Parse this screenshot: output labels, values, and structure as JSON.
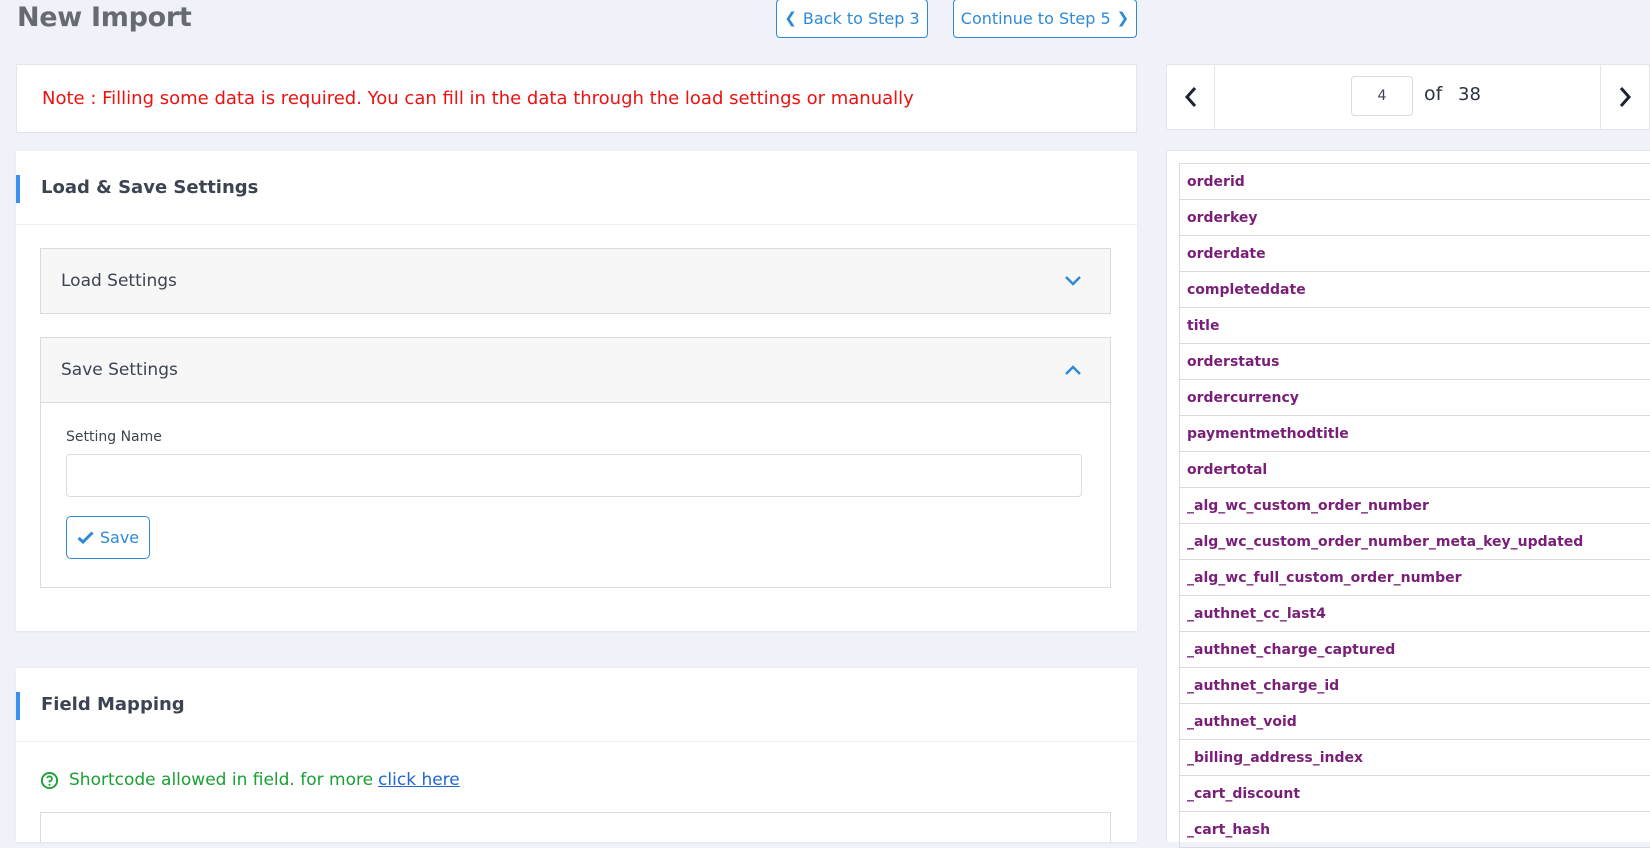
{
  "header": {
    "title": "New Import",
    "back_label": "Back to Step 3",
    "continue_label": "Continue to Step 5"
  },
  "note": {
    "text": "Note : Filling some data is required. You can fill in the data through the load settings or manually"
  },
  "load_save": {
    "title": "Load & Save Settings",
    "load_settings": {
      "label": "Load Settings",
      "expanded": false
    },
    "save_settings": {
      "label": "Save Settings",
      "expanded": true,
      "setting_name_label": "Setting Name",
      "setting_name_value": "",
      "save_label": "Save"
    }
  },
  "field_mapping": {
    "title": "Field Mapping",
    "shortcode_text": "Shortcode allowed in field. for more",
    "link_text": "click here"
  },
  "pager": {
    "current_page": "4",
    "of_label": "of",
    "total_pages": "38"
  },
  "fields": [
    "orderid",
    "orderkey",
    "orderdate",
    "completeddate",
    "title",
    "orderstatus",
    "ordercurrency",
    "paymentmethodtitle",
    "ordertotal",
    "_alg_wc_custom_order_number",
    "_alg_wc_custom_order_number_meta_key_updated",
    "_alg_wc_full_custom_order_number",
    "_authnet_cc_last4",
    "_authnet_charge_captured",
    "_authnet_charge_id",
    "_authnet_void",
    "_billing_address_index",
    "_cart_discount",
    "_cart_hash"
  ],
  "colors": {
    "accent": "#2e8ad8",
    "note_text": "#ee1111",
    "field_text": "#7a1f77",
    "success_text": "#19a033",
    "link": "#1f66d1"
  },
  "icons": {
    "back": "chevron-left-icon",
    "continue": "chevron-right-icon",
    "load_toggle": "chevron-down-icon",
    "save_toggle": "chevron-up-icon",
    "save": "check-icon",
    "help": "question-circle-icon"
  }
}
